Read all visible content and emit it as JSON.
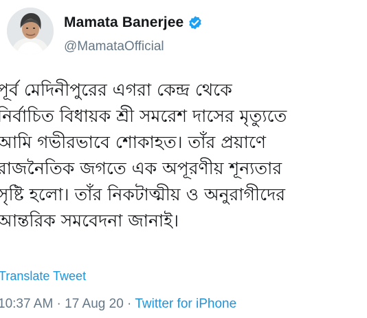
{
  "author": {
    "display_name": "Mamata Banerjee",
    "handle": "@MamataOfficial",
    "verified": true
  },
  "tweet": {
    "text_lines": [
      "পূর্ব মেদিনীপুরের এগরা কেন্দ্র থেকে",
      "নির্বাচিত বিধায়ক শ্রী সমরেশ দাসের মৃত্যুতে",
      "আমি গভীরভাবে শোকাহত। তাঁর প্রয়াণে",
      "রাজনৈতিক জগতে এক অপূরণীয় শূন্যতার",
      "সৃষ্টি হলো। তাঁর নিকটাত্মীয় ও অনুরাগীদের",
      "আন্তরিক সমবেদনা জানাই।"
    ],
    "translate_label": "Translate Tweet",
    "time": "10:37 AM",
    "separator_1": " · ",
    "date": "17 Aug 20",
    "separator_2": " · ",
    "source": "Twitter for iPhone"
  },
  "colors": {
    "text": "#14171a",
    "secondary": "#657786",
    "link": "#1b95e0",
    "verified_badge": "#1da1f2"
  },
  "icons": {
    "verified": "verified-badge-icon"
  }
}
